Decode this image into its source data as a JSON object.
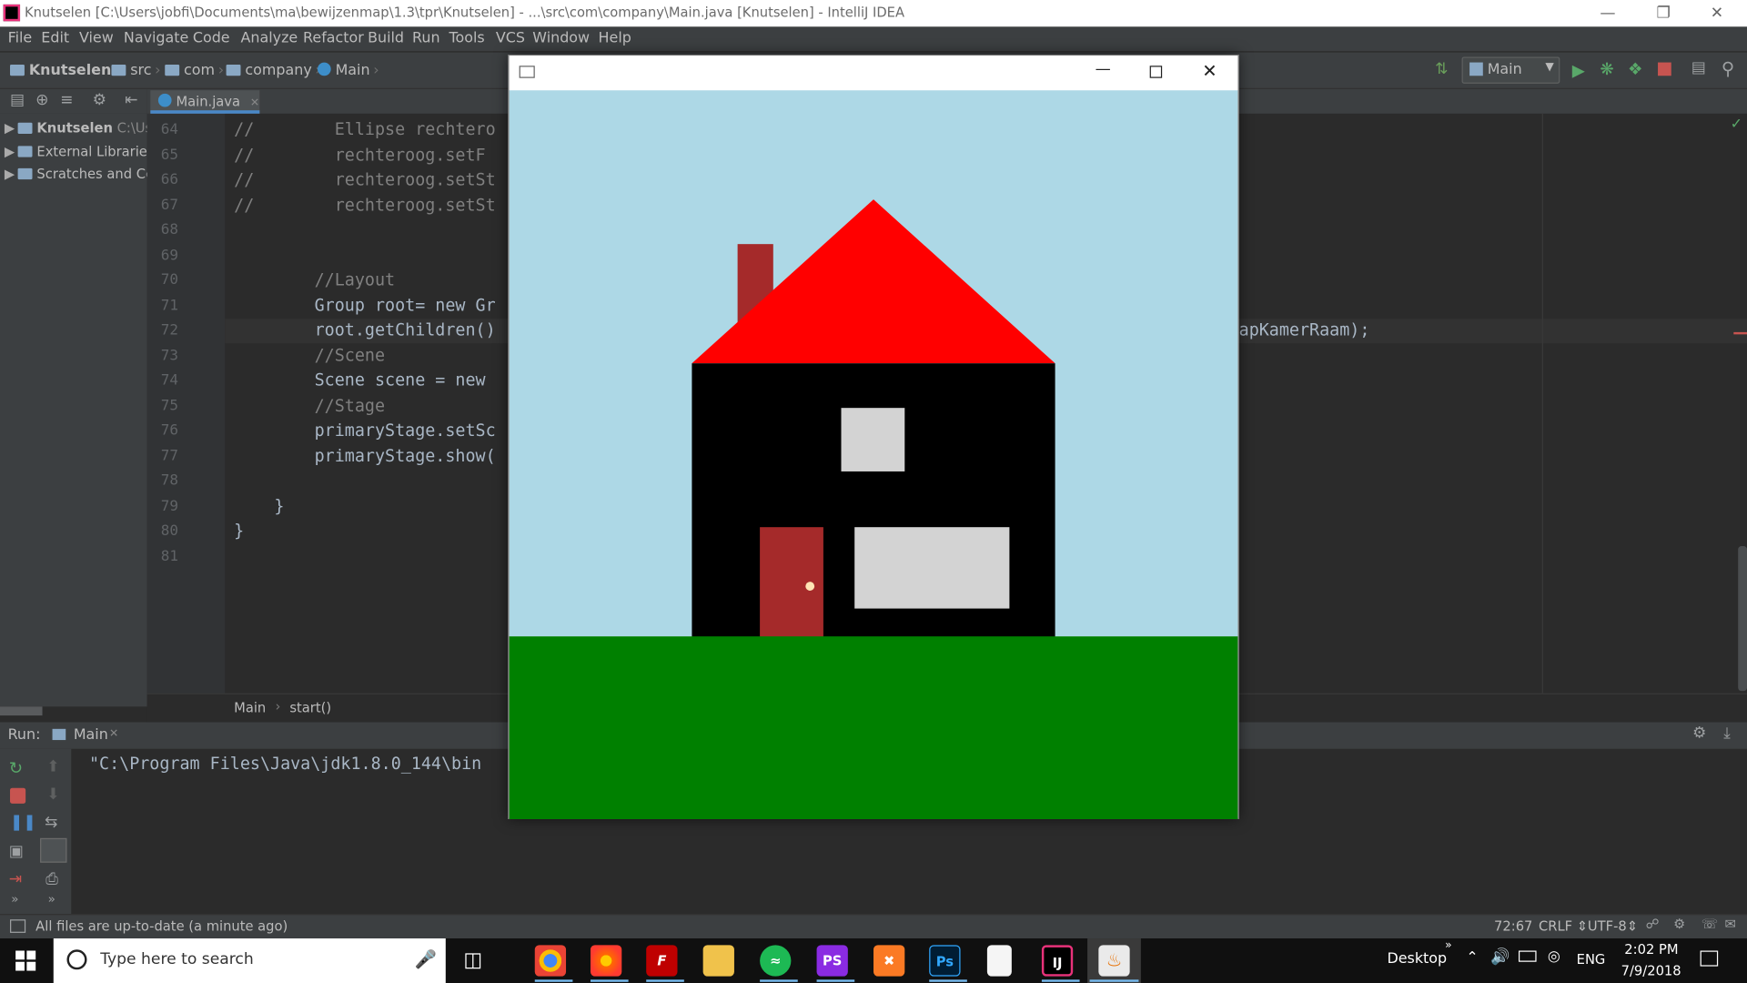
{
  "window": {
    "title": "Knutselen [C:\\Users\\jobfi\\Documents\\ma\\bewijzenmap\\1.3\\tpr\\Knutselen] - ...\\src\\com\\company\\Main.java [Knutselen] - IntelliJ IDEA"
  },
  "menu": [
    "File",
    "Edit",
    "View",
    "Navigate",
    "Code",
    "Analyze",
    "Refactor",
    "Build",
    "Run",
    "Tools",
    "VCS",
    "Window",
    "Help"
  ],
  "breadcrumbs": [
    "Knutselen",
    "src",
    "com",
    "company",
    "Main"
  ],
  "run_config": "Main",
  "editor_tab": "Main.java",
  "project_tree": [
    {
      "name": "Knutselen",
      "extra": "C:\\Us"
    },
    {
      "name": "External Libraries"
    },
    {
      "name": "Scratches and Co"
    }
  ],
  "code_lines": [
    {
      "n": "64",
      "text": "//        Ellipse rechtero"
    },
    {
      "n": "65",
      "text": "//        rechteroog.setF"
    },
    {
      "n": "66",
      "text": "//        rechteroog.setSt"
    },
    {
      "n": "67",
      "text": "//        rechteroog.setSt"
    },
    {
      "n": "68",
      "text": ""
    },
    {
      "n": "69",
      "text": ""
    },
    {
      "n": "70",
      "text": "        //Layout"
    },
    {
      "n": "71",
      "text": "        Group root= new Gr"
    },
    {
      "n": "72",
      "text": "        root.getChildren()"
    },
    {
      "n": "73",
      "text": "        //Scene"
    },
    {
      "n": "74",
      "text": "        Scene scene = new"
    },
    {
      "n": "75",
      "text": "        //Stage"
    },
    {
      "n": "76",
      "text": "        primaryStage.setSc"
    },
    {
      "n": "77",
      "text": "        primaryStage.show("
    },
    {
      "n": "78",
      "text": ""
    },
    {
      "n": "79",
      "text": "    }"
    },
    {
      "n": "80",
      "text": "}"
    },
    {
      "n": "81",
      "text": ""
    }
  ],
  "code_tail_72": "apKamerRaam);",
  "editor_crumb": [
    "Main",
    "start()"
  ],
  "run": {
    "label": "Run:",
    "tab": "Main",
    "console": "\"C:\\Program Files\\Java\\jdk1.8.0_144\\bin"
  },
  "status": {
    "message": "All files are up-to-date (a minute ago)",
    "position": "72:67",
    "line_sep": "CRLF",
    "encoding": "UTF-8"
  },
  "taskbar": {
    "search_placeholder": "Type here to search",
    "desktop_label": "Desktop",
    "lang": "ENG",
    "time": "2:02 PM",
    "date": "7/9/2018"
  },
  "scene_colors": {
    "sky": "#add8e6",
    "grass": "#008000",
    "roof": "#ff0000",
    "chimney": "#a52a2a",
    "wall": "#000000",
    "window": "#d3d3d3",
    "door": "#a52a2a",
    "knob": "#ffe4b5"
  }
}
